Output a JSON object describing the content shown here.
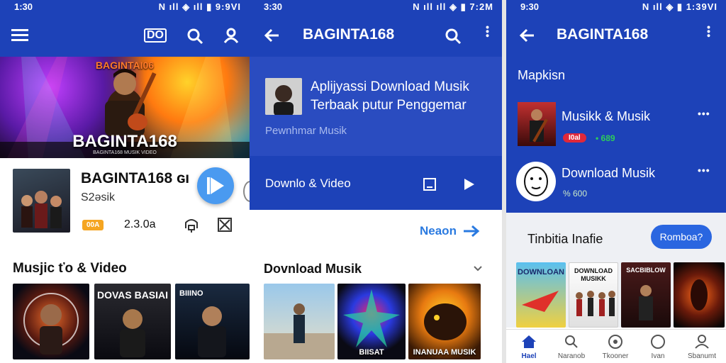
{
  "screen1": {
    "status": {
      "time": "1:30",
      "right": "N ıll ◈ ıll ▮ 9:9VI"
    },
    "appbar": {
      "badge": "DO"
    },
    "hero": {
      "top_label": "BAGINTAI06",
      "big_title": "BAGINTA168",
      "sub": "BAGINTA168 MUSIK VIDEO"
    },
    "track": {
      "title": "BAGINTA168 ɢı",
      "subtitle": "S2əsik",
      "badge": "00A",
      "count": "2.3.0a"
    },
    "section": {
      "title": "Musjic ťo & Video"
    },
    "thumbs": [
      "",
      "DOVAS BASIAI",
      "BIIINO"
    ]
  },
  "screen2": {
    "status": {
      "time": "3:30",
      "right": "N ıll ıll ◈ ▮ 7:2M"
    },
    "appbar": {
      "title": "BAGINTA168"
    },
    "card": {
      "line1": "Aplijyassi Download Musik",
      "line2": "Terbaak putur Penggemar",
      "sub": "Pewnhmar Musik"
    },
    "row": {
      "label": "Downlo & Video"
    },
    "next": {
      "label": "Neaon"
    },
    "section": {
      "title": "Dovnload Musik"
    },
    "thumbs": [
      "",
      "BIISAT",
      "INANUAA MUSIK"
    ]
  },
  "screen3": {
    "status": {
      "time": "9:30",
      "right": "N ıll ◈ ▮ 1:39VI"
    },
    "appbar": {
      "title": "BAGINTA168"
    },
    "section_label": "Mapkisn",
    "items": [
      {
        "title": "Musikk & Musik",
        "badge": "I0al",
        "meta": "• 689"
      },
      {
        "title": "Download Musik",
        "badge": "",
        "meta": "% 600"
      }
    ],
    "promo": {
      "title": "Tinbitia Inafie",
      "button": "Romboa?"
    },
    "thumbs": [
      "DOWNLOAN",
      "DOWNLOAD MUSIKK",
      "SACBIBLOW",
      ""
    ],
    "nav": [
      {
        "label": "Hael",
        "icon": "home-icon"
      },
      {
        "label": "Naranob",
        "icon": "search-icon"
      },
      {
        "label": "Tkooner",
        "icon": "disc-icon"
      },
      {
        "label": "Ivan",
        "icon": "circle-icon"
      },
      {
        "label": "Sbanumt",
        "icon": "person-icon"
      }
    ]
  },
  "colors": {
    "primary": "#1d42b8",
    "accent": "#4a9af0",
    "orange": "#f5a521",
    "red_badge": "#e0283a",
    "green": "#2ecc5a"
  }
}
